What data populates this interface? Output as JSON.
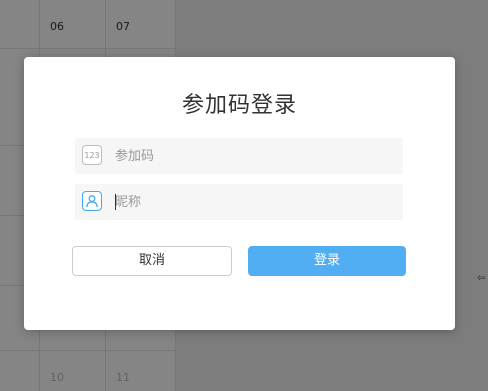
{
  "background": {
    "days": [
      "06",
      "07",
      "10",
      "11"
    ],
    "arrow_glyph": "⇦"
  },
  "dialog": {
    "title": "参加码登录",
    "code_field": {
      "icon": "123",
      "placeholder": "参加码",
      "value": ""
    },
    "nickname_field": {
      "icon": "user-icon",
      "placeholder": "昵称",
      "value": ""
    },
    "cancel_label": "取消",
    "login_label": "登录"
  },
  "colors": {
    "accent": "#52aef2",
    "user_icon": "#4aa8e8",
    "overlay": "rgba(0,0,0,0.48)"
  }
}
